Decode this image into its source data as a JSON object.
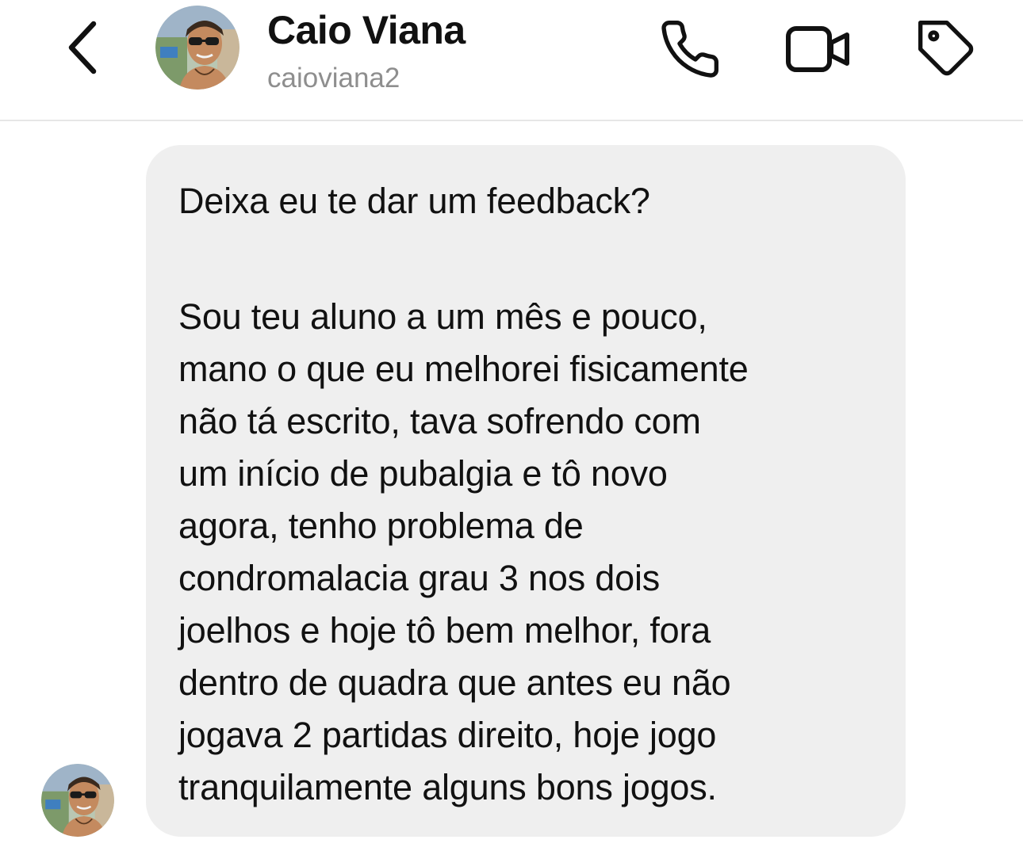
{
  "header": {
    "back_icon": "chevron-left-icon",
    "contact_name": "Caio Viana",
    "contact_username": "caioviana2",
    "actions": [
      {
        "icon": "phone-icon"
      },
      {
        "icon": "video-camera-icon"
      },
      {
        "icon": "tag-icon"
      }
    ]
  },
  "conversation": {
    "message": {
      "first_line": "Deixa eu te dar um feedback?",
      "paragraph_lines": [
        "Sou teu aluno a um mês e pouco,",
        "mano o que eu melhorei fisicamente",
        "não tá escrito, tava sofrendo com",
        "um início de pubalgia e tô novo",
        "agora, tenho problema de",
        "condromalacia grau 3 nos dois",
        "joelhos e hoje tô bem melhor, fora",
        "dentro de quadra que antes eu não",
        "jogava 2 partidas direito, hoje jogo",
        "tranquilamente alguns bons jogos."
      ]
    }
  },
  "colors": {
    "bubble_background": "#efefef",
    "username_gray": "#8e8e8e",
    "icon_stroke": "#111111"
  }
}
